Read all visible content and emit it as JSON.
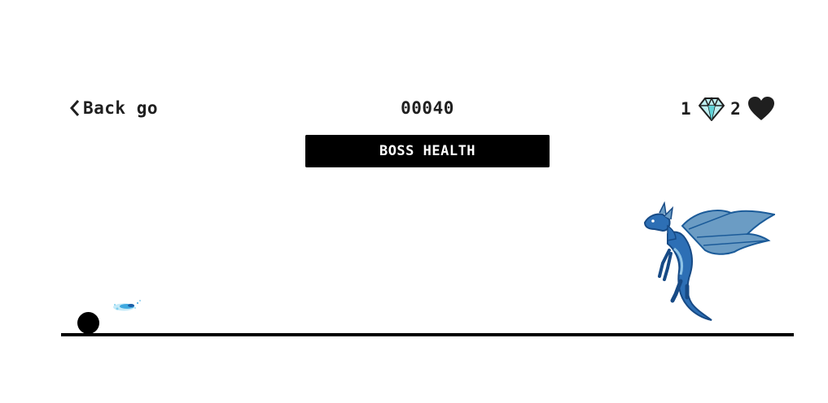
{
  "hud": {
    "back_label": "Back go",
    "score": "00040",
    "gems": "1",
    "lives": "2"
  },
  "boss": {
    "label": "BOSS HEALTH",
    "health_fraction": 1.0
  },
  "icons": {
    "back": "chevron-left-icon",
    "gem": "diamond-icon",
    "life": "heart-icon"
  },
  "colors": {
    "ink": "#1f1f1f",
    "boss_bar": "#000000",
    "boss_text": "#ffffff",
    "ground": "#000000",
    "player": "#000000",
    "gem": "#5fd3d8",
    "dragon_body": "#2d6fb5",
    "dragon_wing": "#6b9cc4",
    "projectile": "#3fa9e0"
  }
}
